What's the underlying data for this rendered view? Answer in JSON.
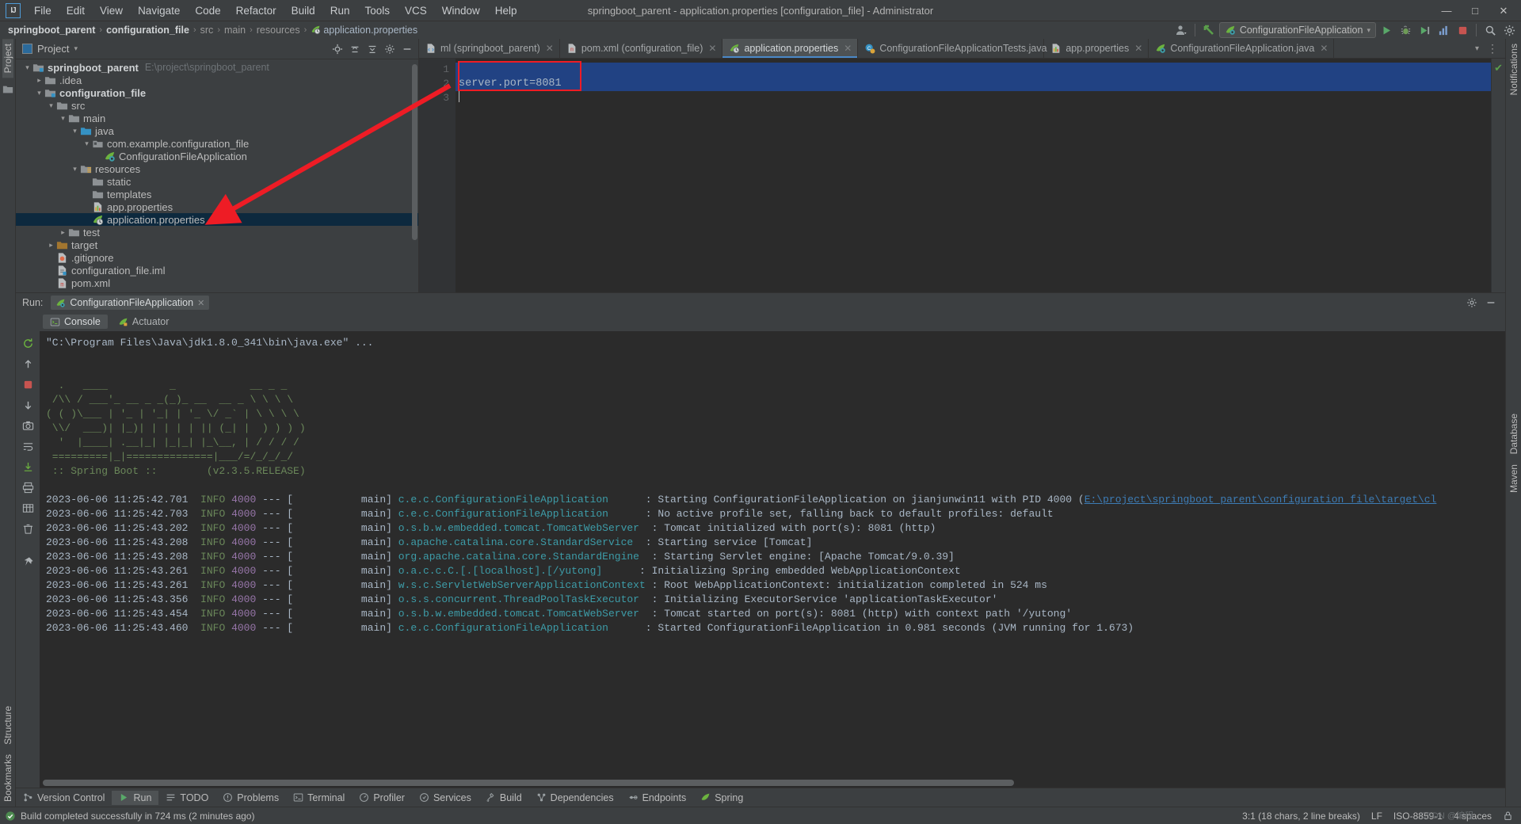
{
  "window": {
    "title": "springboot_parent - application.properties [configuration_file] - Administrator",
    "logo": "IJ",
    "minimize": "—",
    "maximize": "□",
    "close": "✕"
  },
  "menubar": {
    "items": [
      "File",
      "Edit",
      "View",
      "Navigate",
      "Code",
      "Refactor",
      "Build",
      "Run",
      "Tools",
      "VCS",
      "Window",
      "Help"
    ]
  },
  "breadcrumb": {
    "items": [
      {
        "label": "springboot_parent",
        "style": "bold"
      },
      {
        "label": "configuration_file",
        "style": "bold"
      },
      {
        "label": "src",
        "style": "dim"
      },
      {
        "label": "main",
        "style": "dim"
      },
      {
        "label": "resources",
        "style": "dim"
      },
      {
        "label": "application.properties",
        "style": "file"
      }
    ],
    "separator": "›"
  },
  "toolbar": {
    "run_config_label": "ConfigurationFileApplication",
    "icons": [
      "user-avatar-icon",
      "back-arrow-icon",
      "run-icon",
      "debug-icon",
      "run-coverage-icon",
      "profile-icon",
      "stop-icon",
      "search-everywhere-icon",
      "settings-icon"
    ]
  },
  "left_strip": {
    "items": [
      {
        "label": "Project",
        "active": true
      },
      {
        "label": "Structure",
        "active": false
      },
      {
        "label": "Bookmarks",
        "active": false
      }
    ]
  },
  "right_strip": {
    "items": [
      "Notifications",
      "Database",
      "Maven"
    ]
  },
  "project_panel": {
    "title": "Project",
    "chevron": "▾",
    "header_icons": [
      "locate-icon",
      "collapse-all-icon",
      "expand-all-icon",
      "settings-icon",
      "hide-icon"
    ],
    "tree": [
      {
        "indent": 0,
        "arrow": "expanded",
        "icon": "module-folder-icon",
        "label": "springboot_parent",
        "bold": true,
        "path": "E:\\project\\springboot_parent",
        "selected": false
      },
      {
        "indent": 1,
        "arrow": "collapsed",
        "icon": "folder-icon",
        "label": ".idea",
        "bold": false,
        "path": "",
        "selected": false
      },
      {
        "indent": 1,
        "arrow": "expanded",
        "icon": "module-folder-icon",
        "label": "configuration_file",
        "bold": true,
        "path": "",
        "selected": false
      },
      {
        "indent": 2,
        "arrow": "expanded",
        "icon": "folder-icon",
        "label": "src",
        "bold": false,
        "path": "",
        "selected": false
      },
      {
        "indent": 3,
        "arrow": "expanded",
        "icon": "folder-icon",
        "label": "main",
        "bold": false,
        "path": "",
        "selected": false
      },
      {
        "indent": 4,
        "arrow": "expanded",
        "icon": "source-folder-icon",
        "label": "java",
        "bold": false,
        "path": "",
        "selected": false
      },
      {
        "indent": 5,
        "arrow": "expanded",
        "icon": "package-icon",
        "label": "com.example.configuration_file",
        "bold": false,
        "path": "",
        "selected": false
      },
      {
        "indent": 6,
        "arrow": "none",
        "icon": "spring-class-icon",
        "label": "ConfigurationFileApplication",
        "bold": false,
        "path": "",
        "selected": false
      },
      {
        "indent": 4,
        "arrow": "expanded",
        "icon": "resources-folder-icon",
        "label": "resources",
        "bold": false,
        "path": "",
        "selected": false
      },
      {
        "indent": 5,
        "arrow": "none",
        "icon": "folder-icon",
        "label": "static",
        "bold": false,
        "path": "",
        "selected": false
      },
      {
        "indent": 5,
        "arrow": "none",
        "icon": "folder-icon",
        "label": "templates",
        "bold": false,
        "path": "",
        "selected": false
      },
      {
        "indent": 5,
        "arrow": "none",
        "icon": "properties-icon",
        "label": "app.properties",
        "bold": false,
        "path": "",
        "selected": false
      },
      {
        "indent": 5,
        "arrow": "none",
        "icon": "spring-properties-icon",
        "label": "application.properties",
        "bold": false,
        "path": "",
        "selected": true
      },
      {
        "indent": 3,
        "arrow": "collapsed",
        "icon": "folder-icon",
        "label": "test",
        "bold": false,
        "path": "",
        "selected": false
      },
      {
        "indent": 2,
        "arrow": "collapsed",
        "icon": "target-folder-icon",
        "label": "target",
        "bold": false,
        "path": "",
        "selected": false
      },
      {
        "indent": 2,
        "arrow": "none",
        "icon": "gitignore-icon",
        "label": ".gitignore",
        "bold": false,
        "path": "",
        "selected": false
      },
      {
        "indent": 2,
        "arrow": "none",
        "icon": "iml-icon",
        "label": "configuration_file.iml",
        "bold": false,
        "path": "",
        "selected": false
      },
      {
        "indent": 2,
        "arrow": "none",
        "icon": "maven-icon",
        "label": "pom.xml",
        "bold": false,
        "path": "",
        "selected": false
      }
    ]
  },
  "editor": {
    "tabs": [
      {
        "label": "ml (springboot_parent)",
        "icon": "xml-icon",
        "active": false,
        "close": "✕"
      },
      {
        "label": "pom.xml (configuration_file)",
        "icon": "maven-icon",
        "active": false,
        "close": "✕"
      },
      {
        "label": "application.properties",
        "icon": "spring-properties-icon",
        "active": true,
        "close": "✕"
      },
      {
        "label": "ConfigurationFileApplicationTests.java",
        "icon": "test-class-icon",
        "active": false,
        "close": "✕"
      },
      {
        "label": "app.properties",
        "icon": "properties-icon",
        "active": false,
        "close": "✕"
      },
      {
        "label": "ConfigurationFileApplication.java",
        "icon": "spring-class-icon",
        "active": false,
        "close": "✕"
      }
    ],
    "tab_actions": [
      "chevron-down-icon",
      "more-icon"
    ],
    "gutter_lines": [
      "1",
      "2",
      "3"
    ],
    "lines": [
      {
        "n": 1,
        "text": "",
        "selected": true
      },
      {
        "n": 2,
        "text": "server.port=8081",
        "selected": true
      },
      {
        "n": 3,
        "text": "",
        "selected": false
      }
    ],
    "inspection_status": "✔"
  },
  "annotation": {
    "arrow_color": "#ee1c25",
    "box_color": "#ee1c25"
  },
  "run_panel": {
    "label": "Run:",
    "config_tab": "ConfigurationFileApplication",
    "config_tab_close": "✕",
    "sub_tabs": [
      {
        "label": "Console",
        "icon": "console-icon",
        "active": true
      },
      {
        "label": "Actuator",
        "icon": "actuator-icon",
        "active": false
      }
    ],
    "head_icons": [
      "settings-icon",
      "hide-icon"
    ],
    "tool_icons": [
      "rerun-icon",
      "up-icon",
      "stop-icon",
      "down-icon",
      "camera-icon",
      "soft-wrap-icon",
      "scroll-end-icon",
      "print-icon",
      "clear-all-icon",
      "table-icon",
      "trash-icon",
      "pin-icon"
    ],
    "console": [
      {
        "segs": [
          {
            "t": "\"C:\\Program Files\\Java\\jdk1.8.0_341\\bin\\java.exe\" ...",
            "c": "c-gray"
          }
        ]
      },
      {
        "segs": [
          {
            "t": "",
            "c": "c-gray"
          }
        ]
      },
      {
        "segs": [
          {
            "t": "",
            "c": "c-gray"
          }
        ]
      },
      {
        "segs": [
          {
            "t": "  .   ____          _            __ _ _",
            "c": "c-green"
          }
        ]
      },
      {
        "segs": [
          {
            "t": " /\\\\ / ___'_ __ _ _(_)_ __  __ _ \\ \\ \\ \\",
            "c": "c-green"
          }
        ]
      },
      {
        "segs": [
          {
            "t": "( ( )\\___ | '_ | '_| | '_ \\/ _` | \\ \\ \\ \\",
            "c": "c-green"
          }
        ]
      },
      {
        "segs": [
          {
            "t": " \\\\/  ___)| |_)| | | | | || (_| |  ) ) ) )",
            "c": "c-green"
          }
        ]
      },
      {
        "segs": [
          {
            "t": "  '  |____| .__|_| |_|_| |_\\__, | / / / /",
            "c": "c-green"
          }
        ]
      },
      {
        "segs": [
          {
            "t": " =========|_|==============|___/=/_/_/_/",
            "c": "c-green"
          }
        ]
      },
      {
        "segs": [
          {
            "t": " :: Spring Boot ::        (v2.3.5.RELEASE)",
            "c": "c-green"
          }
        ]
      },
      {
        "segs": [
          {
            "t": "",
            "c": "c-gray"
          }
        ]
      },
      {
        "segs": [
          {
            "t": "2023-06-06 11:25:42.701  ",
            "c": "c-ts"
          },
          {
            "t": "INFO",
            "c": "c-info"
          },
          {
            "t": " ",
            "c": "c-ts"
          },
          {
            "t": "4000",
            "c": "c-pid"
          },
          {
            "t": " --- [           main] ",
            "c": "c-ts"
          },
          {
            "t": "c.e.c.ConfigurationFileApplication   ",
            "c": "c-cls"
          },
          {
            "t": "   : Starting ConfigurationFileApplication on jianjunwin11 with PID 4000 (",
            "c": "c-ts"
          },
          {
            "t": "E:\\project\\springboot_parent\\configuration_file\\target\\cl",
            "c": "c-link"
          }
        ]
      },
      {
        "segs": [
          {
            "t": "2023-06-06 11:25:42.703  ",
            "c": "c-ts"
          },
          {
            "t": "INFO",
            "c": "c-info"
          },
          {
            "t": " ",
            "c": "c-ts"
          },
          {
            "t": "4000",
            "c": "c-pid"
          },
          {
            "t": " --- [           main] ",
            "c": "c-ts"
          },
          {
            "t": "c.e.c.ConfigurationFileApplication   ",
            "c": "c-cls"
          },
          {
            "t": "   : No active profile set, falling back to default profiles: default",
            "c": "c-ts"
          }
        ]
      },
      {
        "segs": [
          {
            "t": "2023-06-06 11:25:43.202  ",
            "c": "c-ts"
          },
          {
            "t": "INFO",
            "c": "c-info"
          },
          {
            "t": " ",
            "c": "c-ts"
          },
          {
            "t": "4000",
            "c": "c-pid"
          },
          {
            "t": " --- [           main] ",
            "c": "c-ts"
          },
          {
            "t": "o.s.b.w.embedded.tomcat.TomcatWebServer",
            "c": "c-cls"
          },
          {
            "t": "  : Tomcat initialized with port(s): 8081 (http)",
            "c": "c-ts"
          }
        ]
      },
      {
        "segs": [
          {
            "t": "2023-06-06 11:25:43.208  ",
            "c": "c-ts"
          },
          {
            "t": "INFO",
            "c": "c-info"
          },
          {
            "t": " ",
            "c": "c-ts"
          },
          {
            "t": "4000",
            "c": "c-pid"
          },
          {
            "t": " --- [           main] ",
            "c": "c-ts"
          },
          {
            "t": "o.apache.catalina.core.StandardService ",
            "c": "c-cls"
          },
          {
            "t": " : Starting service [Tomcat]",
            "c": "c-ts"
          }
        ]
      },
      {
        "segs": [
          {
            "t": "2023-06-06 11:25:43.208  ",
            "c": "c-ts"
          },
          {
            "t": "INFO",
            "c": "c-info"
          },
          {
            "t": " ",
            "c": "c-ts"
          },
          {
            "t": "4000",
            "c": "c-pid"
          },
          {
            "t": " --- [           main] ",
            "c": "c-ts"
          },
          {
            "t": "org.apache.catalina.core.StandardEngine",
            "c": "c-cls"
          },
          {
            "t": "  : Starting Servlet engine: [Apache Tomcat/9.0.39]",
            "c": "c-ts"
          }
        ]
      },
      {
        "segs": [
          {
            "t": "2023-06-06 11:25:43.261  ",
            "c": "c-ts"
          },
          {
            "t": "INFO",
            "c": "c-info"
          },
          {
            "t": " ",
            "c": "c-ts"
          },
          {
            "t": "4000",
            "c": "c-pid"
          },
          {
            "t": " --- [           main] ",
            "c": "c-ts"
          },
          {
            "t": "o.a.c.c.C.[.[localhost].[/yutong]    ",
            "c": "c-cls"
          },
          {
            "t": "  : Initializing Spring embedded WebApplicationContext",
            "c": "c-ts"
          }
        ]
      },
      {
        "segs": [
          {
            "t": "2023-06-06 11:25:43.261  ",
            "c": "c-ts"
          },
          {
            "t": "INFO",
            "c": "c-info"
          },
          {
            "t": " ",
            "c": "c-ts"
          },
          {
            "t": "4000",
            "c": "c-pid"
          },
          {
            "t": " --- [           main] ",
            "c": "c-ts"
          },
          {
            "t": "w.s.c.ServletWebServerApplicationContext",
            "c": "c-cls"
          },
          {
            "t": " : Root WebApplicationContext: initialization completed in 524 ms",
            "c": "c-ts"
          }
        ]
      },
      {
        "segs": [
          {
            "t": "2023-06-06 11:25:43.356  ",
            "c": "c-ts"
          },
          {
            "t": "INFO",
            "c": "c-info"
          },
          {
            "t": " ",
            "c": "c-ts"
          },
          {
            "t": "4000",
            "c": "c-pid"
          },
          {
            "t": " --- [           main] ",
            "c": "c-ts"
          },
          {
            "t": "o.s.s.concurrent.ThreadPoolTaskExecutor",
            "c": "c-cls"
          },
          {
            "t": "  : Initializing ExecutorService 'applicationTaskExecutor'",
            "c": "c-ts"
          }
        ]
      },
      {
        "segs": [
          {
            "t": "2023-06-06 11:25:43.454  ",
            "c": "c-ts"
          },
          {
            "t": "INFO",
            "c": "c-info"
          },
          {
            "t": " ",
            "c": "c-ts"
          },
          {
            "t": "4000",
            "c": "c-pid"
          },
          {
            "t": " --- [           main] ",
            "c": "c-ts"
          },
          {
            "t": "o.s.b.w.embedded.tomcat.TomcatWebServer",
            "c": "c-cls"
          },
          {
            "t": "  : Tomcat started on port(s): 8081 (http) with context path '/yutong'",
            "c": "c-ts"
          }
        ]
      },
      {
        "segs": [
          {
            "t": "2023-06-06 11:25:43.460  ",
            "c": "c-ts"
          },
          {
            "t": "INFO",
            "c": "c-info"
          },
          {
            "t": " ",
            "c": "c-ts"
          },
          {
            "t": "4000",
            "c": "c-pid"
          },
          {
            "t": " --- [           main] ",
            "c": "c-ts"
          },
          {
            "t": "c.e.c.ConfigurationFileApplication   ",
            "c": "c-cls"
          },
          {
            "t": "   : Started ConfigurationFileApplication in 0.981 seconds (JVM running for 1.673)",
            "c": "c-ts"
          }
        ]
      }
    ]
  },
  "bottom_bar": {
    "items": [
      {
        "label": "Version Control",
        "icon": "vcs-icon",
        "active": false
      },
      {
        "label": "Run",
        "icon": "run-icon",
        "active": true
      },
      {
        "label": "TODO",
        "icon": "todo-icon",
        "active": false
      },
      {
        "label": "Problems",
        "icon": "problems-icon",
        "active": false
      },
      {
        "label": "Terminal",
        "icon": "terminal-icon",
        "active": false
      },
      {
        "label": "Profiler",
        "icon": "profiler-icon",
        "active": false
      },
      {
        "label": "Services",
        "icon": "services-icon",
        "active": false
      },
      {
        "label": "Build",
        "icon": "build-icon",
        "active": false
      },
      {
        "label": "Dependencies",
        "icon": "dependencies-icon",
        "active": false
      },
      {
        "label": "Endpoints",
        "icon": "endpoints-icon",
        "active": false
      },
      {
        "label": "Spring",
        "icon": "spring-icon",
        "active": false
      }
    ]
  },
  "status_bar": {
    "message": "Build completed successfully in 724 ms (2 minutes ago)",
    "caret": "3:1 (18 chars, 2 line breaks)",
    "line_sep": "LF",
    "encoding": "ISO-8859-1",
    "indent": "4 spaces",
    "watermark": "CSDN @编程"
  }
}
